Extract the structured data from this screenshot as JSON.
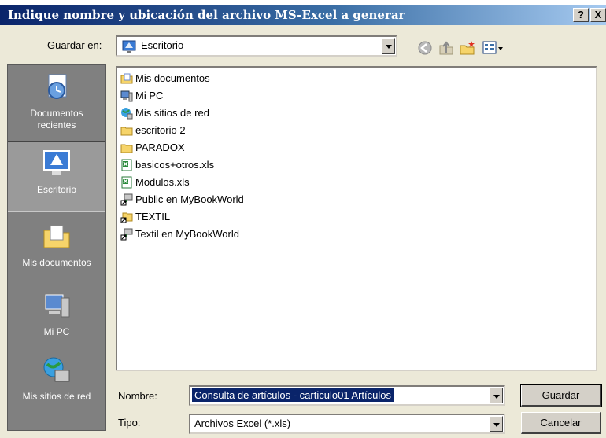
{
  "window": {
    "title": "Indique nombre y ubicación del archivo MS-Excel a generar",
    "help_btn": "?",
    "close_btn": "X"
  },
  "toolbar": {
    "save_in_label": "Guardar en:",
    "save_in_value": "Escritorio"
  },
  "places": [
    {
      "label": "Documentos recientes",
      "icon": "recent-documents-icon"
    },
    {
      "label": "Escritorio",
      "icon": "desktop-icon",
      "active": true
    },
    {
      "label": "Mis documentos",
      "icon": "my-documents-icon"
    },
    {
      "label": "Mi PC",
      "icon": "my-computer-icon"
    },
    {
      "label": "Mis sitios de red",
      "icon": "network-places-icon"
    }
  ],
  "files": [
    {
      "name": "Mis documentos",
      "icon": "folder-documents-icon"
    },
    {
      "name": "Mi PC",
      "icon": "computer-icon"
    },
    {
      "name": "Mis sitios de red",
      "icon": "network-icon"
    },
    {
      "name": "escritorio 2",
      "icon": "folder-icon"
    },
    {
      "name": "PARADOX",
      "icon": "folder-icon"
    },
    {
      "name": "basicos+otros.xls",
      "icon": "excel-file-icon"
    },
    {
      "name": "Modulos.xls",
      "icon": "excel-file-icon"
    },
    {
      "name": "Public en MyBookWorld",
      "icon": "network-shortcut-icon"
    },
    {
      "name": "TEXTIL",
      "icon": "folder-shortcut-icon"
    },
    {
      "name": "Textil en MyBookWorld",
      "icon": "network-shortcut-icon"
    }
  ],
  "form": {
    "name_label": "Nombre:",
    "name_value": "Consulta de artículos - carticulo01 Artículos",
    "type_label": "Tipo:",
    "type_value": "Archivos Excel (*.xls)",
    "save_button": "Guardar",
    "cancel_button": "Cancelar"
  },
  "colors": {
    "titlebar_start": "#0a246a",
    "titlebar_end": "#a6caf0",
    "dialog_face": "#ece9d8",
    "places_bg": "#808080"
  }
}
